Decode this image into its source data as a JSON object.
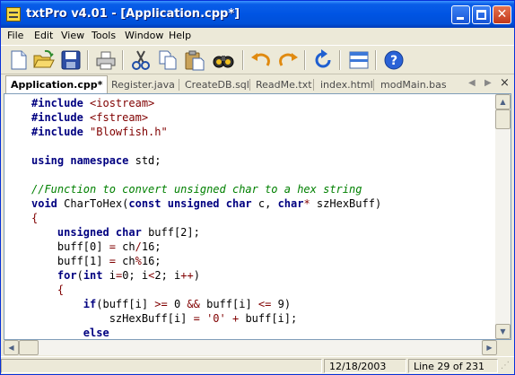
{
  "window": {
    "title": "txtPro v4.01 - [Application.cpp*]",
    "close_glyph": "✕"
  },
  "menu": [
    "File",
    "Edit",
    "View",
    "Tools",
    "Window",
    "Help"
  ],
  "toolbar": {
    "buttons": [
      "new-document",
      "open-folder",
      "save",
      "print",
      "cut",
      "copy",
      "paste",
      "find",
      "undo",
      "redo",
      "refresh",
      "split-view",
      "help"
    ]
  },
  "tabs": {
    "items": [
      "Application.cpp*",
      "Register.java",
      "CreateDB.sql",
      "ReadMe.txt",
      "index.html",
      "modMain.bas"
    ],
    "active_index": 0,
    "left_arrow": "◀",
    "right_arrow": "▶",
    "close": "×"
  },
  "code_lines": [
    [
      [
        "kw",
        "#include "
      ],
      [
        "str",
        "<iostream>"
      ]
    ],
    [
      [
        "kw",
        "#include "
      ],
      [
        "str",
        "<fstream>"
      ]
    ],
    [
      [
        "kw",
        "#include "
      ],
      [
        "str",
        "\"Blowfish.h\""
      ]
    ],
    [],
    [
      [
        "kw",
        "using namespace "
      ],
      [
        "tx",
        "std;"
      ]
    ],
    [],
    [
      [
        "cmt",
        "//Function to convert unsigned char to a hex string"
      ]
    ],
    [
      [
        "kw",
        "void "
      ],
      [
        "tx",
        "CharToHex("
      ],
      [
        "kw",
        "const unsigned char "
      ],
      [
        "tx",
        "c, "
      ],
      [
        "kw",
        "char"
      ],
      [
        "op",
        "* "
      ],
      [
        "tx",
        "szHexBuff)"
      ]
    ],
    [
      [
        "op",
        "{"
      ]
    ],
    [
      [
        "tx",
        "    "
      ],
      [
        "kw",
        "unsigned char "
      ],
      [
        "tx",
        "buff[2];"
      ]
    ],
    [
      [
        "tx",
        "    buff[0] "
      ],
      [
        "op",
        "= "
      ],
      [
        "tx",
        "ch"
      ],
      [
        "op",
        "/"
      ],
      [
        "tx",
        "16;"
      ]
    ],
    [
      [
        "tx",
        "    buff[1] "
      ],
      [
        "op",
        "= "
      ],
      [
        "tx",
        "ch"
      ],
      [
        "op",
        "%"
      ],
      [
        "tx",
        "16;"
      ]
    ],
    [
      [
        "tx",
        "    "
      ],
      [
        "kw",
        "for"
      ],
      [
        "tx",
        "("
      ],
      [
        "kw",
        "int "
      ],
      [
        "tx",
        "i"
      ],
      [
        "op",
        "="
      ],
      [
        "tx",
        "0; i"
      ],
      [
        "op",
        "<"
      ],
      [
        "tx",
        "2; i"
      ],
      [
        "op",
        "++"
      ],
      [
        "tx",
        ")"
      ]
    ],
    [
      [
        "tx",
        "    "
      ],
      [
        "op",
        "{"
      ]
    ],
    [
      [
        "tx",
        "        "
      ],
      [
        "kw",
        "if"
      ],
      [
        "tx",
        "(buff[i] "
      ],
      [
        "op",
        ">= "
      ],
      [
        "tx",
        "0 "
      ],
      [
        "op",
        "&& "
      ],
      [
        "tx",
        "buff[i] "
      ],
      [
        "op",
        "<= "
      ],
      [
        "tx",
        "9)"
      ]
    ],
    [
      [
        "tx",
        "            szHexBuff[i] "
      ],
      [
        "op",
        "= "
      ],
      [
        "str",
        "'0' "
      ],
      [
        "op",
        "+ "
      ],
      [
        "tx",
        "buff[i];"
      ]
    ],
    [
      [
        "tx",
        "        "
      ],
      [
        "kw",
        "else"
      ]
    ]
  ],
  "status": {
    "date": "12/18/2003",
    "position": "Line 29 of 231"
  },
  "colors": {
    "titlebar": "#0054e3",
    "keyword": "#000080",
    "string": "#800000",
    "comment": "#008000"
  }
}
